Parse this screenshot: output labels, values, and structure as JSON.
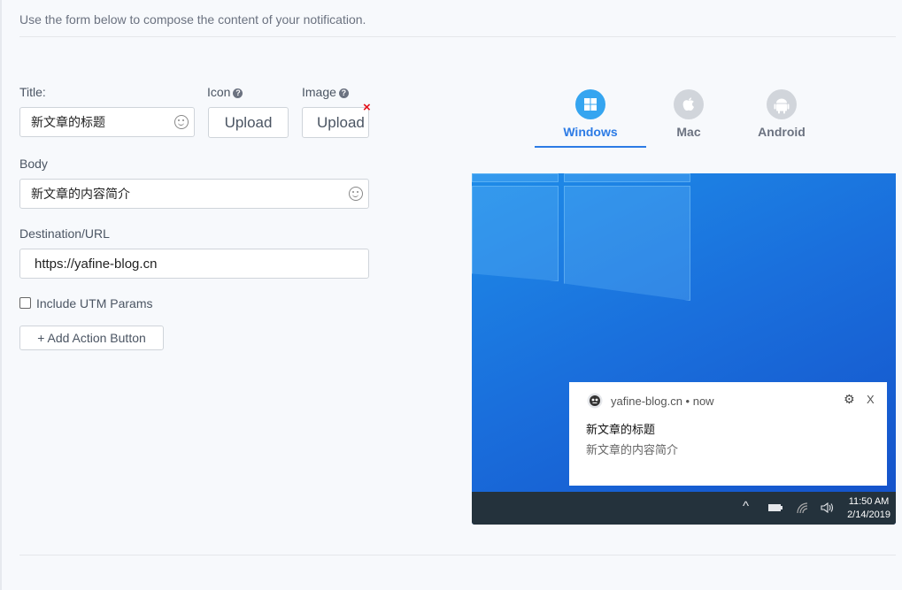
{
  "intro_text": "Use the form below to compose the content of your notification.",
  "form": {
    "title_label": "Title:",
    "title_value": "新文章的标题",
    "icon_label": "Icon",
    "image_label": "Image",
    "upload_label": "Upload",
    "remove_mark": "×",
    "body_label": "Body",
    "body_value": "新文章的内容简介",
    "url_label": "Destination/URL",
    "url_value": "https://yafine-blog.cn",
    "utm_label": "Include UTM Params",
    "action_button": "+ Add Action Button"
  },
  "tabs": [
    {
      "label": "Windows",
      "icon": "windows-icon",
      "active": true
    },
    {
      "label": "Mac",
      "icon": "apple-icon",
      "active": false
    },
    {
      "label": "Android",
      "icon": "android-icon",
      "active": false
    }
  ],
  "preview": {
    "site": "yafine-blog.cn • now",
    "title": "新文章的标题",
    "body": "新文章的内容简介",
    "close": "X",
    "time": "11:50 AM",
    "date": "2/14/2019"
  },
  "colors": {
    "accent": "#2c7be5",
    "remove": "#e3101a",
    "taskbar": "#24323c"
  }
}
